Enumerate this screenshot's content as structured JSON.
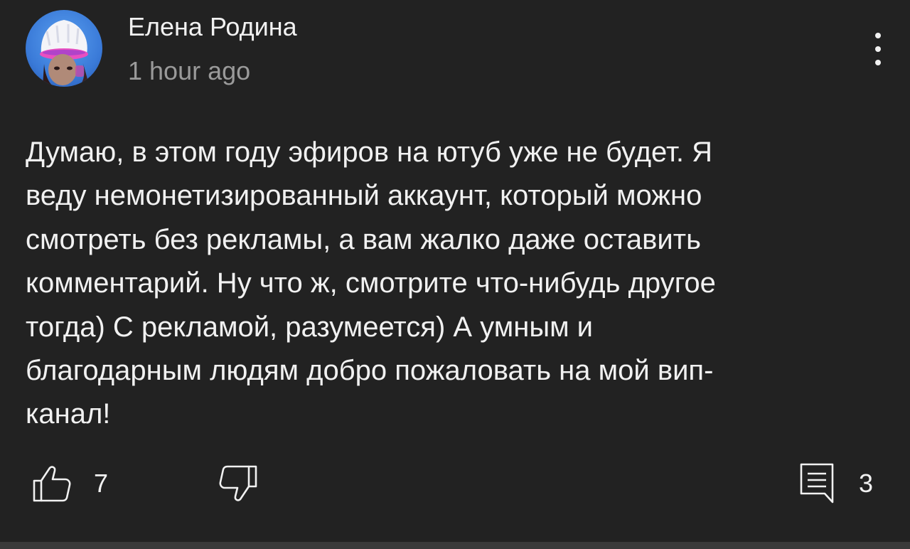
{
  "comment": {
    "author": "Елена Родина",
    "timestamp": "1 hour ago",
    "text_lines": [
      "Думаю, в этом году эфиров на ютуб уже не будет. Я",
      "веду немонетизированный аккаунт, который можно",
      "смотреть без рекламы, а вам жалко даже оставить",
      "комментарий. Ну что ж, смотрите что-нибудь другое",
      "тогда) С рекламой, разумеется) А умным и",
      "благодарным людям добро пожаловать на мой вип-",
      "канал!"
    ],
    "likes": "7",
    "replies": "3"
  },
  "icons": {
    "avatar": "avatar-photo",
    "more": "more-vertical-icon",
    "like": "thumbs-up-icon",
    "dislike": "thumbs-down-icon",
    "reply": "reply-comment-icon"
  },
  "colors": {
    "background": "#222222",
    "text": "#f1f1f1",
    "secondary_text": "#9a9a9a"
  }
}
